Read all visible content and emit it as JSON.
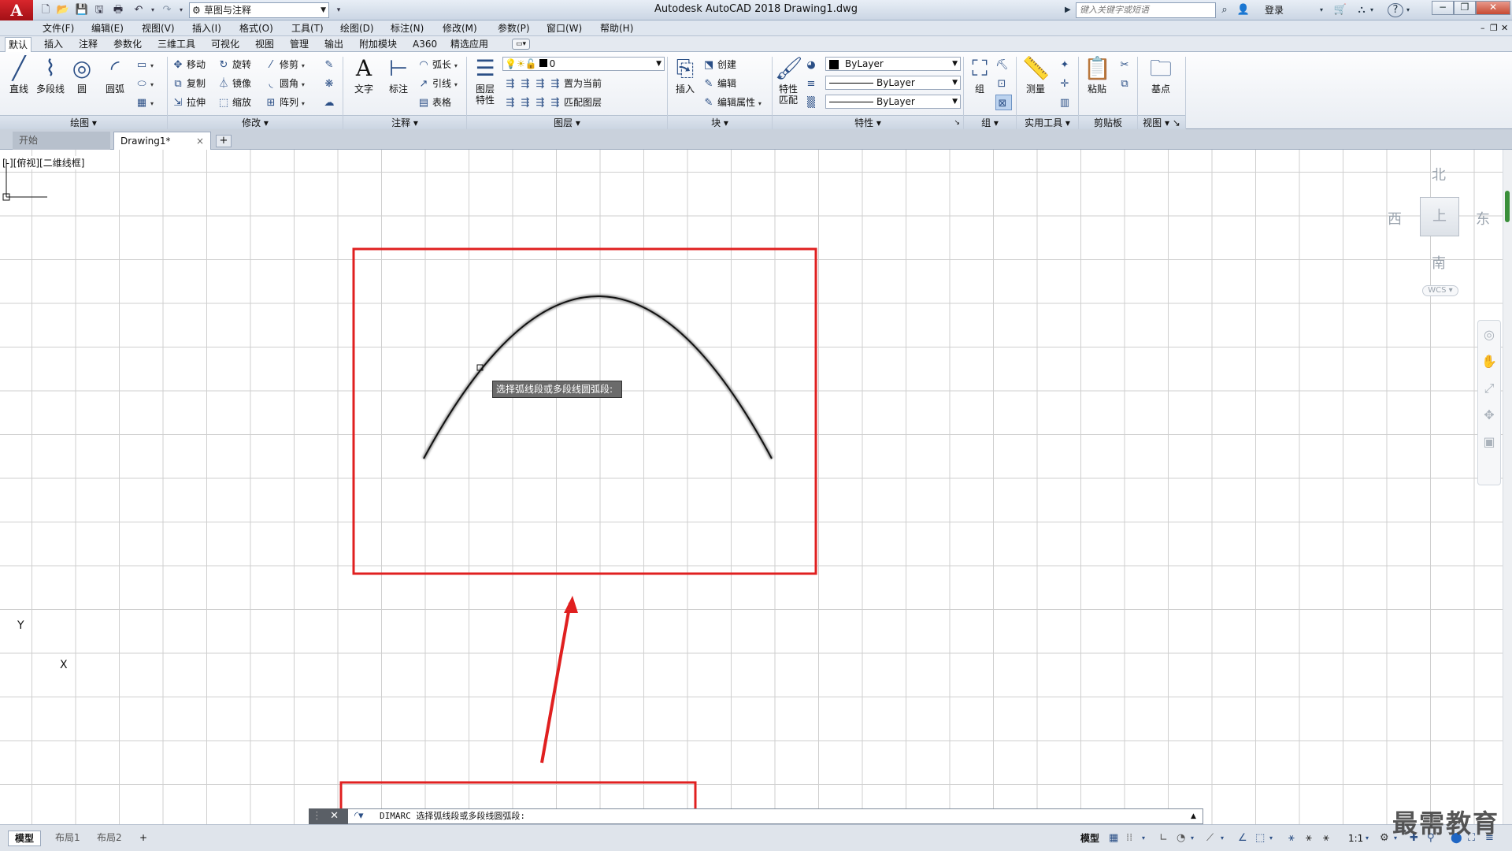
{
  "app": {
    "logo": "A",
    "title": "Autodesk AutoCAD 2018    Drawing1.dwg",
    "workspace": "草图与注释",
    "search_placeholder": "键入关键字或短语",
    "login": "登录",
    "help": "?"
  },
  "menu": [
    "文件(F)",
    "编辑(E)",
    "视图(V)",
    "插入(I)",
    "格式(O)",
    "工具(T)",
    "绘图(D)",
    "标注(N)",
    "修改(M)",
    "参数(P)",
    "窗口(W)",
    "帮助(H)"
  ],
  "ribbon_tabs": [
    "默认",
    "插入",
    "注释",
    "参数化",
    "三维工具",
    "可视化",
    "视图",
    "管理",
    "输出",
    "附加模块",
    "A360",
    "精选应用"
  ],
  "panels": {
    "draw": {
      "title": "绘图",
      "line": "直线",
      "polyline": "多段线",
      "circle": "圆",
      "arc": "圆弧"
    },
    "modify": {
      "title": "修改",
      "move": "移动",
      "rotate": "旋转",
      "trim": "修剪",
      "copy": "复制",
      "mirror": "镜像",
      "fillet": "圆角",
      "stretch": "拉伸",
      "scale": "缩放",
      "array": "阵列"
    },
    "annotation": {
      "title": "注释",
      "text": "文字",
      "dimension": "标注",
      "arc_length": "弧长",
      "leader": "引线",
      "table": "表格"
    },
    "layers": {
      "title": "图层",
      "layer_props_1": "图层",
      "layer_props_2": "特性",
      "layer_value": "0",
      "set_current": "置为当前",
      "match_layer": "匹配图层"
    },
    "block": {
      "title": "块",
      "insert": "插入",
      "create": "创建",
      "edit": "编辑",
      "edit_attr": "编辑属性"
    },
    "properties": {
      "title": "特性",
      "match_1": "特性",
      "match_2": "匹配",
      "color": "ByLayer",
      "linetype": "ByLayer",
      "lineweight": "ByLayer"
    },
    "groups": {
      "title": "组",
      "group": "组"
    },
    "utilities": {
      "title": "实用工具",
      "measure": "测量"
    },
    "clipboard": {
      "title": "剪贴板",
      "paste": "粘贴"
    },
    "view": {
      "title": "视图",
      "base": "基点"
    }
  },
  "doc_tabs": {
    "start": "开始",
    "drawing": "Drawing1*",
    "close": "×",
    "new": "+"
  },
  "viewport_label": "[-][俯视][二维线框]",
  "tooltip": "选择弧线段或多段线圆弧段:",
  "viewcube": {
    "north": "北",
    "south": "南",
    "east": "东",
    "west": "西",
    "top": "上",
    "wcs": "WCS"
  },
  "ucs": {
    "x": "X",
    "y": "Y"
  },
  "command": {
    "text": "DIMARC 选择弧线段或多段线圆弧段:"
  },
  "layout_tabs": [
    "模型",
    "布局1",
    "布局2"
  ],
  "status": {
    "model": "模型",
    "scale": "1:1"
  },
  "watermark": "最需教育"
}
